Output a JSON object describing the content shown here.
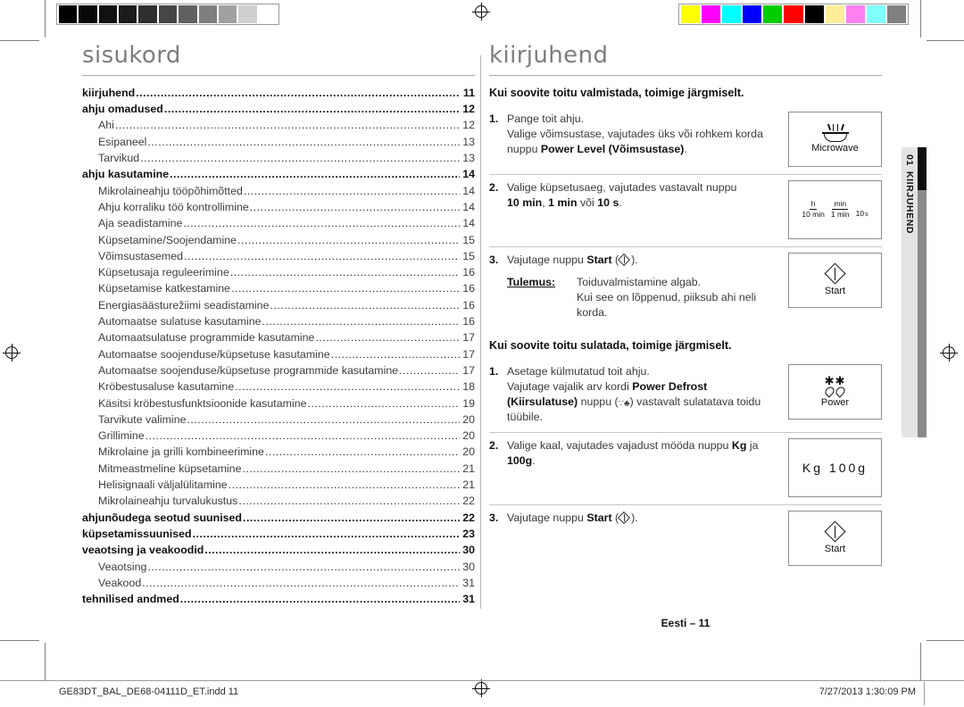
{
  "calibration": {
    "gray_label": "grayscale-calibration-bar",
    "gray_swatches": [
      "#010101",
      "#080808",
      "#111111",
      "#1b1b1b",
      "#2f2f2f",
      "#464646",
      "#606060",
      "#7f7f7f",
      "#a0a0a0",
      "#cfcfcf",
      "#ffffff"
    ],
    "color_label": "color-calibration-bar",
    "color_swatches": [
      "#ffff00",
      "#ff00ff",
      "#00ffff",
      "#0000ff",
      "#00cc00",
      "#ff0000",
      "#000000",
      "#ffee99",
      "#ff80f0",
      "#80ffff",
      "#808080"
    ]
  },
  "left_column": {
    "title": "sisukord",
    "toc": [
      {
        "label": "kiirjuhend",
        "page": "11",
        "level": 1
      },
      {
        "label": "ahju omadused",
        "page": "12",
        "level": 1
      },
      {
        "label": "Ahi",
        "page": "12",
        "level": 2
      },
      {
        "label": "Esipaneel",
        "page": "13",
        "level": 2
      },
      {
        "label": "Tarvikud",
        "page": "13",
        "level": 2
      },
      {
        "label": "ahju kasutamine",
        "page": "14",
        "level": 1
      },
      {
        "label": "Mikrolaineahju tööpõhimõtted",
        "page": "14",
        "level": 2
      },
      {
        "label": "Ahju korraliku töö kontrollimine",
        "page": "14",
        "level": 2
      },
      {
        "label": "Aja seadistamine",
        "page": "14",
        "level": 2
      },
      {
        "label": "Küpsetamine/Soojendamine",
        "page": "15",
        "level": 2
      },
      {
        "label": "Võimsustasemed",
        "page": "15",
        "level": 2
      },
      {
        "label": "Küpsetusaja reguleerimine",
        "page": "16",
        "level": 2
      },
      {
        "label": "Küpsetamise katkestamine",
        "page": "16",
        "level": 2
      },
      {
        "label": "Energiasäästurežiimi seadistamine",
        "page": "16",
        "level": 2
      },
      {
        "label": "Automaatse sulatuse kasutamine",
        "page": "16",
        "level": 2
      },
      {
        "label": "Automaatsulatuse programmide kasutamine",
        "page": "17",
        "level": 2
      },
      {
        "label": "Automaatse soojenduse/küpsetuse kasutamine",
        "page": "17",
        "level": 2
      },
      {
        "label": "Automaatse soojenduse/küpsetuse programmide kasutamine",
        "page": "17",
        "level": 2
      },
      {
        "label": "Kröbestusaluse kasutamine",
        "page": "18",
        "level": 2
      },
      {
        "label": "Käsitsi kröbestusfunktsioonide kasutamine",
        "page": "19",
        "level": 2
      },
      {
        "label": "Tarvikute valimine",
        "page": "20",
        "level": 2
      },
      {
        "label": "Grillimine",
        "page": "20",
        "level": 2
      },
      {
        "label": "Mikrolaine ja grilli kombineerimine",
        "page": "20",
        "level": 2
      },
      {
        "label": "Mitmeastmeline küpsetamine",
        "page": "21",
        "level": 2
      },
      {
        "label": "Helisignaali väljalülitamine",
        "page": "21",
        "level": 2
      },
      {
        "label": "Mikrolaineahju turvalukustus",
        "page": "22",
        "level": 2
      },
      {
        "label": "ahjunõudega seotud suunised",
        "page": "22",
        "level": 1
      },
      {
        "label": "küpsetamissuunised",
        "page": "23",
        "level": 1
      },
      {
        "label": "veaotsing ja veakoodid",
        "page": "30",
        "level": 1
      },
      {
        "label": "Veaotsing",
        "page": "30",
        "level": 2
      },
      {
        "label": "Veakood",
        "page": "31",
        "level": 2
      },
      {
        "label": "tehnilised andmed",
        "page": "31",
        "level": 1
      }
    ]
  },
  "right_column": {
    "title": "kiirjuhend",
    "section_cook": {
      "heading": "Kui soovite toitu valmistada, toimige järgmiselt.",
      "steps": [
        {
          "num": "1.",
          "line1": "Pange toit ahju.",
          "line2_a": "Valige võimsustase, vajutades üks või rohkem korda",
          "line2_b": "nuppu ",
          "line2_bold": "Power Level (Võimsustase)",
          "line2_c": ".",
          "art_label": "Microwave",
          "art_icon": "microwave-icon"
        },
        {
          "num": "2.",
          "line1_a": "Valige küpsetusaeg, vajutades vastavalt nuppu",
          "bold1": "10 min",
          "mid1": ", ",
          "bold2": "1 min",
          "mid2": " või ",
          "bold3": "10 s",
          "tail": ".",
          "art_icon": "time-keys-icon",
          "keys": [
            {
              "top": "h",
              "bottom": "10 min"
            },
            {
              "top": "min",
              "bottom": "1 min"
            },
            {
              "plain": "10",
              "small": "s"
            }
          ]
        },
        {
          "num": "3.",
          "pre": "Vajutage nuppu ",
          "bold": "Start",
          "post": " (",
          "post2": ").",
          "result_label": "Tulemus:",
          "result_line1": "Toiduvalmistamine algab.",
          "result_line2": "Kui see on lõppenud, piiksub ahi neli",
          "result_line3": "korda.",
          "art_label": "Start",
          "art_icon": "start-diamond-icon"
        }
      ]
    },
    "section_defrost": {
      "heading": "Kui soovite toitu sulatada, toimige järgmiselt.",
      "steps": [
        {
          "num": "1.",
          "line1": "Asetage külmutatud toit ahju.",
          "line2_a": "Vajutage vajalik arv kordi ",
          "line2_bold": "Power Defrost",
          "line3_bold": "(Kiirsulatuse)",
          "line3_a": " nuppu (",
          "line3_b": ") vastavalt sulatatava toidu",
          "line4": "tüübile.",
          "art_label": "Power",
          "art_icon": "power-defrost-icon"
        },
        {
          "num": "2.",
          "line1_a": "Valige kaal, vajutades vajadust mööda nuppu ",
          "bold1": "Kg",
          "line1_b": " ja",
          "bold2": "100g",
          "tail": ".",
          "art_label_kg": "Kg",
          "art_label_100g": "100g",
          "art_icon": "kg-100g-keys-icon"
        },
        {
          "num": "3.",
          "pre": "Vajutage nuppu ",
          "bold": "Start",
          "post": " (",
          "post2": ").",
          "art_label": "Start",
          "art_icon": "start-diamond-icon"
        }
      ]
    },
    "page_mark": "Eesti – 11"
  },
  "side_tab": {
    "number": "01",
    "label": "KIIRJUHEND"
  },
  "slug": {
    "filename": "GE83DT_BAL_DE68-04111D_ET.indd   11",
    "timestamp": "7/27/2013   1:30:09 PM"
  }
}
